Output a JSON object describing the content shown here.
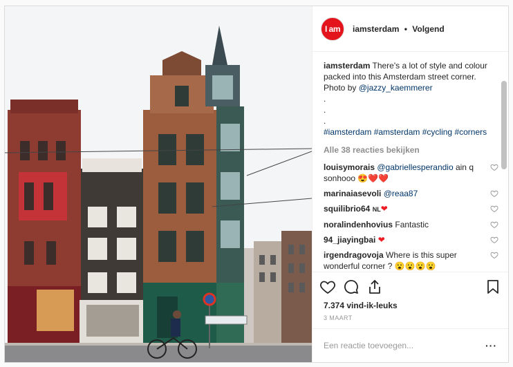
{
  "post": {
    "photo_alt": "",
    "author": "iamsterdam",
    "avatar_text": "I am",
    "follow_separator": "•",
    "follow_label": "Volgend",
    "caption": {
      "user": "iamsterdam",
      "text": "There's a lot of style and colour packed into this Amsterdam street corner.",
      "photo_by_prefix": "Photo by",
      "photo_by_handle": "@jazzy_kaemmerer",
      "dots": [
        ".",
        ".",
        "."
      ],
      "hashtags": [
        "#iamsterdam",
        "#amsterdam",
        "#cycling",
        "#corners"
      ]
    },
    "view_all": "Alle 38 reacties bekijken",
    "comments": [
      {
        "user": "louisymorais",
        "mention": "@gabriellesperandio",
        "text": "ain q sonhooo",
        "emoji": "😍❤️❤️"
      },
      {
        "user": "marinaiasevoli",
        "mention": "@reaa87",
        "text": "",
        "emoji": ""
      },
      {
        "user": "squilibrio64",
        "mention": "",
        "text": "NL",
        "emoji": "❤"
      },
      {
        "user": "noralindenhovius",
        "mention": "",
        "text": "Fantastic",
        "emoji": ""
      },
      {
        "user": "94_jiayingbai",
        "mention": "",
        "text": "",
        "emoji": "❤"
      },
      {
        "user": "irgendragovoja",
        "mention": "",
        "text": "Where is this super wonderful corner ?",
        "emoji": "😮😮😮😮"
      }
    ],
    "likes": "7.374 vind-ik-leuks",
    "date": "3 MAART",
    "add_comment_placeholder": "Een reactie toevoegen...",
    "more_label": "···",
    "icons": {
      "like": "heart-icon",
      "comment": "comment-bubble-icon",
      "share": "share-icon",
      "save": "bookmark-icon",
      "comment_like": "small-heart-icon"
    },
    "colors": {
      "brand_red": "#e3141b",
      "link_blue": "#003569",
      "muted": "#8e8e8e"
    }
  }
}
